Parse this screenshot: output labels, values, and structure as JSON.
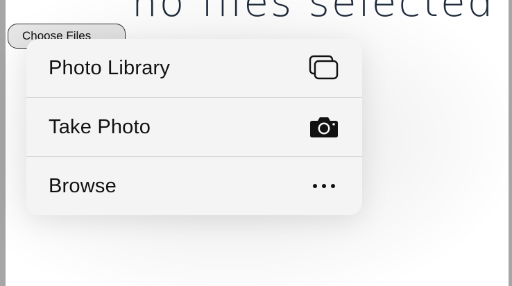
{
  "page": {
    "status_text": "no files selected",
    "choose_files_label": "Choose Files"
  },
  "menu": {
    "items": [
      {
        "label": "Photo Library",
        "icon": "photo-library-icon"
      },
      {
        "label": "Take Photo",
        "icon": "camera-icon"
      },
      {
        "label": "Browse",
        "icon": "more-ellipsis-icon"
      }
    ]
  },
  "colors": {
    "status_text": "#1f2a3c",
    "menu_background": "#f4f4f4",
    "menu_divider": "#d6d6d6",
    "outer_background": "#a6a6a6"
  }
}
